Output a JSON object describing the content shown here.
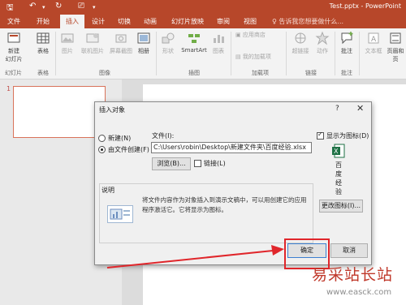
{
  "titlebar": {
    "window_title": "Test.pptx - PowerPoint"
  },
  "tabs": [
    "文件",
    "开始",
    "插入",
    "设计",
    "切换",
    "动画",
    "幻灯片放映",
    "审阅",
    "视图"
  ],
  "tellme": "告诉我您想要做什么...",
  "ribbon": {
    "new_slide": "新建\n幻灯片",
    "table": "表格",
    "picture": "图片",
    "online_picture": "联机图片",
    "screenshot": "屏幕截图",
    "album": "相册",
    "shapes": "形状",
    "smartart": "SmartArt",
    "chart": "图表",
    "store": "应用商店",
    "my_addins": "我的加载项",
    "hyperlink": "超链接",
    "action": "动作",
    "comment": "批注",
    "textbox": "文本框",
    "header_footer": "页眉和页",
    "group_slides": "幻灯片",
    "group_tables": "表格",
    "group_images": "图像",
    "group_illustrations": "插图",
    "group_addins": "加载项",
    "group_links": "链接",
    "group_comments": "批注"
  },
  "slides": {
    "number": "1"
  },
  "dialog": {
    "title": "插入对象",
    "help": "?",
    "close": "✕",
    "radio_new": "新建(N)",
    "radio_from_file": "由文件创建(F)",
    "file_label": "文件(I):",
    "file_path": "C:\\Users\\robin\\Desktop\\新建文件夹\\百度经验.xlsx",
    "browse": "浏览(B)...",
    "link": "链接(L)",
    "display_as_icon": "显示为图标(D)",
    "icon_caption": "百\n度\n经\n验",
    "change_icon": "更改图标(I)...",
    "desc_title": "说明",
    "desc_text": "将文件内容作为对象插入到演示文稿中，可以用创建它的应用程序激活它。它将显示为图标。",
    "ok": "确定",
    "cancel": "取消"
  },
  "watermark": {
    "line1": "易采站长站",
    "line2": "www.easck.com"
  },
  "colors": {
    "accent": "#b7472a",
    "annotation": "#e0262b"
  }
}
